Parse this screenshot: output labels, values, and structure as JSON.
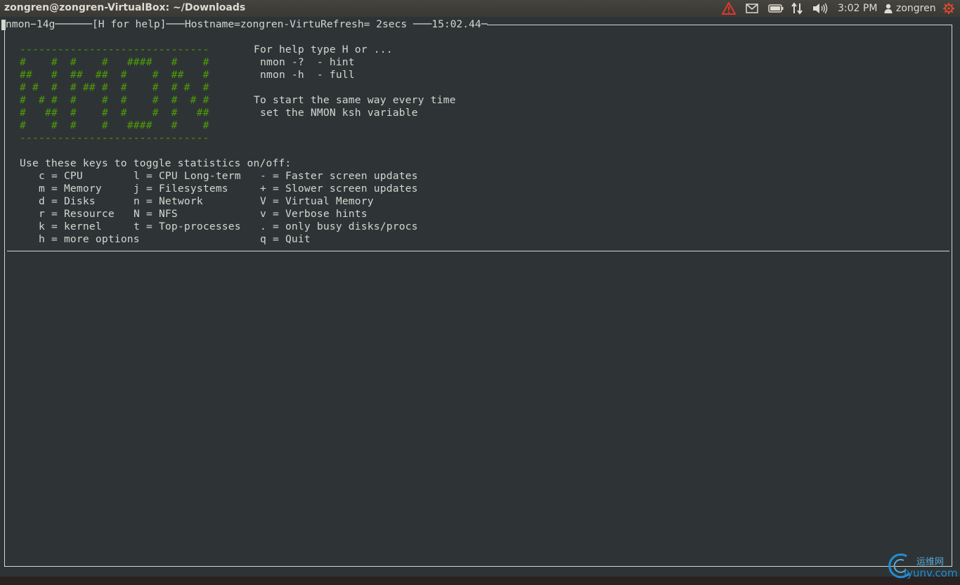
{
  "panel": {
    "window_title": "zongren@zongren-VirtualBox: ~/Downloads",
    "clock": "3:02 PM",
    "user": "zongren"
  },
  "terminal": {
    "header": {
      "prog": "nmon−14g",
      "help": "[H for help]",
      "host": "Hostname=zongren-Virtu",
      "refresh": "Refresh= 2secs",
      "time": "15:02.44"
    },
    "logo_lines": [
      "------------------------------",
      "#    #  #    #   ####   #    #",
      "##   #  ##  ##  #    #  ##   #",
      "# #  #  # ## #  #    #  # #  #",
      "#  # #  #    #  #    #  #  # #",
      "#   ##  #    #  #    #  #   ##",
      "#    #  #    #   ####   #    #",
      "------------------------------"
    ],
    "help_lines": [
      "For help type H or ...",
      " nmon -?  - hint",
      " nmon -h  - full",
      "",
      "To start the same way every time",
      " set the NMON ksh variable"
    ],
    "keys_intro": "Use these keys to toggle statistics on/off:",
    "key_rows": [
      [
        "c = CPU",
        "l = CPU Long-term",
        "- = Faster screen updates"
      ],
      [
        "m = Memory",
        "j = Filesystems",
        "+ = Slower screen updates"
      ],
      [
        "d = Disks",
        "n = Network",
        "V = Virtual Memory"
      ],
      [
        "r = Resource",
        "N = NFS",
        "v = Verbose hints"
      ],
      [
        "k = kernel",
        "t = Top-processes",
        ". = only busy disks/procs"
      ],
      [
        "h = more options",
        "",
        "q = Quit"
      ]
    ]
  },
  "watermark": {
    "line1": "运维网",
    "line2": "iyunv.com"
  },
  "colors": {
    "terminal_bg": "#2e3436",
    "terminal_fg": "#d3d7cf",
    "logo_green": "#4e9a06",
    "panel_bg": "#3c3b37"
  },
  "icons": [
    "alert-icon",
    "mail-icon",
    "battery-icon",
    "network-icon",
    "volume-icon",
    "user-icon",
    "session-gear-icon"
  ]
}
